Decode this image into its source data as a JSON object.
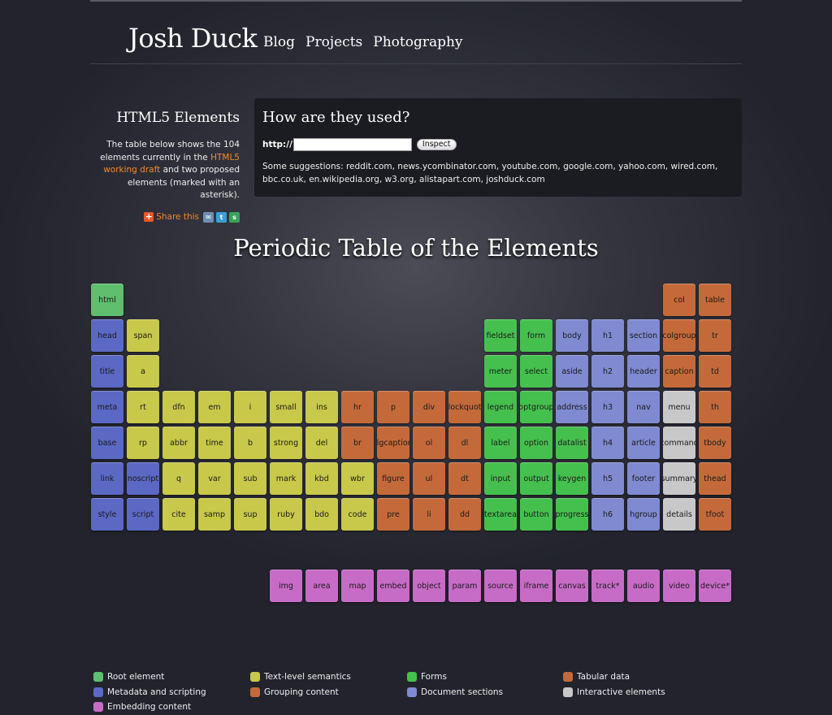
{
  "site": {
    "title": "Josh Duck",
    "nav": [
      "Blog",
      "Projects",
      "Photography"
    ]
  },
  "sidebar": {
    "heading": "HTML5 Elements",
    "intro_before": "The table below shows the 104 elements currently in the ",
    "link_text": "HTML5 working draft",
    "intro_after": " and two proposed elements (marked with an asterisk).",
    "share_label": "Share this"
  },
  "panel": {
    "heading": "How are they used?",
    "url_prefix": "http://",
    "url_value": "",
    "inspect_label": "Inspect",
    "suggestions": "Some suggestions: reddit.com, news.ycombinator.com, youtube.com, google.com, yahoo.com, wired.com, bbc.co.uk, en.wikipedia.org, w3.org, alistapart.com, joshduck.com"
  },
  "table_title": "Periodic Table of the Elements",
  "colors": {
    "root": "#5fbf6e",
    "meta": "#5b68c4",
    "text": "#c8c84a",
    "group": "#c46a3a",
    "form": "#45c04e",
    "section": "#7f8ad0",
    "tabular": "#c46a3a",
    "interactive": "#c8c8c8",
    "embed": "#c76cc6"
  },
  "elements": [
    {
      "n": "html",
      "c": "root",
      "col": 0,
      "row": 0
    },
    {
      "n": "head",
      "c": "meta",
      "col": 0,
      "row": 1
    },
    {
      "n": "title",
      "c": "meta",
      "col": 0,
      "row": 2
    },
    {
      "n": "meta",
      "c": "meta",
      "col": 0,
      "row": 3
    },
    {
      "n": "base",
      "c": "meta",
      "col": 0,
      "row": 4
    },
    {
      "n": "link",
      "c": "meta",
      "col": 0,
      "row": 5
    },
    {
      "n": "style",
      "c": "meta",
      "col": 0,
      "row": 6
    },
    {
      "n": "span",
      "c": "text",
      "col": 1,
      "row": 1
    },
    {
      "n": "a",
      "c": "text",
      "col": 1,
      "row": 2
    },
    {
      "n": "rt",
      "c": "text",
      "col": 1,
      "row": 3
    },
    {
      "n": "rp",
      "c": "text",
      "col": 1,
      "row": 4
    },
    {
      "n": "noscript",
      "c": "meta",
      "col": 1,
      "row": 5
    },
    {
      "n": "script",
      "c": "meta",
      "col": 1,
      "row": 6
    },
    {
      "n": "dfn",
      "c": "text",
      "col": 2,
      "row": 3
    },
    {
      "n": "abbr",
      "c": "text",
      "col": 2,
      "row": 4
    },
    {
      "n": "q",
      "c": "text",
      "col": 2,
      "row": 5
    },
    {
      "n": "cite",
      "c": "text",
      "col": 2,
      "row": 6
    },
    {
      "n": "em",
      "c": "text",
      "col": 3,
      "row": 3
    },
    {
      "n": "time",
      "c": "text",
      "col": 3,
      "row": 4
    },
    {
      "n": "var",
      "c": "text",
      "col": 3,
      "row": 5
    },
    {
      "n": "samp",
      "c": "text",
      "col": 3,
      "row": 6
    },
    {
      "n": "i",
      "c": "text",
      "col": 4,
      "row": 3
    },
    {
      "n": "b",
      "c": "text",
      "col": 4,
      "row": 4
    },
    {
      "n": "sub",
      "c": "text",
      "col": 4,
      "row": 5
    },
    {
      "n": "sup",
      "c": "text",
      "col": 4,
      "row": 6
    },
    {
      "n": "small",
      "c": "text",
      "col": 5,
      "row": 3
    },
    {
      "n": "strong",
      "c": "text",
      "col": 5,
      "row": 4
    },
    {
      "n": "mark",
      "c": "text",
      "col": 5,
      "row": 5
    },
    {
      "n": "ruby",
      "c": "text",
      "col": 5,
      "row": 6
    },
    {
      "n": "ins",
      "c": "text",
      "col": 6,
      "row": 3
    },
    {
      "n": "del",
      "c": "text",
      "col": 6,
      "row": 4
    },
    {
      "n": "kbd",
      "c": "text",
      "col": 6,
      "row": 5
    },
    {
      "n": "bdo",
      "c": "text",
      "col": 6,
      "row": 6
    },
    {
      "n": "hr",
      "c": "group",
      "col": 7,
      "row": 3
    },
    {
      "n": "br",
      "c": "group",
      "col": 7,
      "row": 4
    },
    {
      "n": "wbr",
      "c": "text",
      "col": 7,
      "row": 5
    },
    {
      "n": "code",
      "c": "text",
      "col": 7,
      "row": 6
    },
    {
      "n": "p",
      "c": "group",
      "col": 8,
      "row": 3
    },
    {
      "n": "figcaption",
      "c": "group",
      "col": 8,
      "row": 4
    },
    {
      "n": "figure",
      "c": "group",
      "col": 8,
      "row": 5
    },
    {
      "n": "pre",
      "c": "group",
      "col": 8,
      "row": 6
    },
    {
      "n": "div",
      "c": "group",
      "col": 9,
      "row": 3
    },
    {
      "n": "ol",
      "c": "group",
      "col": 9,
      "row": 4
    },
    {
      "n": "ul",
      "c": "group",
      "col": 9,
      "row": 5
    },
    {
      "n": "li",
      "c": "group",
      "col": 9,
      "row": 6
    },
    {
      "n": "blockquote",
      "c": "group",
      "col": 10,
      "row": 3
    },
    {
      "n": "dl",
      "c": "group",
      "col": 10,
      "row": 4
    },
    {
      "n": "dt",
      "c": "group",
      "col": 10,
      "row": 5
    },
    {
      "n": "dd",
      "c": "group",
      "col": 10,
      "row": 6
    },
    {
      "n": "fieldset",
      "c": "form",
      "col": 11,
      "row": 1
    },
    {
      "n": "meter",
      "c": "form",
      "col": 11,
      "row": 2
    },
    {
      "n": "legend",
      "c": "form",
      "col": 11,
      "row": 3
    },
    {
      "n": "label",
      "c": "form",
      "col": 11,
      "row": 4
    },
    {
      "n": "input",
      "c": "form",
      "col": 11,
      "row": 5
    },
    {
      "n": "textarea",
      "c": "form",
      "col": 11,
      "row": 6
    },
    {
      "n": "form",
      "c": "form",
      "col": 12,
      "row": 1
    },
    {
      "n": "select",
      "c": "form",
      "col": 12,
      "row": 2
    },
    {
      "n": "optgroup",
      "c": "form",
      "col": 12,
      "row": 3
    },
    {
      "n": "option",
      "c": "form",
      "col": 12,
      "row": 4
    },
    {
      "n": "output",
      "c": "form",
      "col": 12,
      "row": 5
    },
    {
      "n": "button",
      "c": "form",
      "col": 12,
      "row": 6
    },
    {
      "n": "body",
      "c": "section",
      "col": 13,
      "row": 1
    },
    {
      "n": "aside",
      "c": "section",
      "col": 13,
      "row": 2
    },
    {
      "n": "address",
      "c": "section",
      "col": 13,
      "row": 3
    },
    {
      "n": "datalist",
      "c": "form",
      "col": 13,
      "row": 4
    },
    {
      "n": "keygen",
      "c": "form",
      "col": 13,
      "row": 5
    },
    {
      "n": "progress",
      "c": "form",
      "col": 13,
      "row": 6
    },
    {
      "n": "h1",
      "c": "section",
      "col": 14,
      "row": 1
    },
    {
      "n": "h2",
      "c": "section",
      "col": 14,
      "row": 2
    },
    {
      "n": "h3",
      "c": "section",
      "col": 14,
      "row": 3
    },
    {
      "n": "h4",
      "c": "section",
      "col": 14,
      "row": 4
    },
    {
      "n": "h5",
      "c": "section",
      "col": 14,
      "row": 5
    },
    {
      "n": "h6",
      "c": "section",
      "col": 14,
      "row": 6
    },
    {
      "n": "section",
      "c": "section",
      "col": 15,
      "row": 1
    },
    {
      "n": "header",
      "c": "section",
      "col": 15,
      "row": 2
    },
    {
      "n": "nav",
      "c": "section",
      "col": 15,
      "row": 3
    },
    {
      "n": "article",
      "c": "section",
      "col": 15,
      "row": 4
    },
    {
      "n": "footer",
      "c": "section",
      "col": 15,
      "row": 5
    },
    {
      "n": "hgroup",
      "c": "section",
      "col": 15,
      "row": 6
    },
    {
      "n": "col",
      "c": "tabular",
      "col": 16,
      "row": 0
    },
    {
      "n": "colgroup",
      "c": "tabular",
      "col": 16,
      "row": 1
    },
    {
      "n": "caption",
      "c": "tabular",
      "col": 16,
      "row": 2
    },
    {
      "n": "menu",
      "c": "interactive",
      "col": 16,
      "row": 3
    },
    {
      "n": "command",
      "c": "interactive",
      "col": 16,
      "row": 4
    },
    {
      "n": "summary",
      "c": "interactive",
      "col": 16,
      "row": 5
    },
    {
      "n": "details",
      "c": "interactive",
      "col": 16,
      "row": 6
    },
    {
      "n": "table",
      "c": "tabular",
      "col": 17,
      "row": 0
    },
    {
      "n": "tr",
      "c": "tabular",
      "col": 17,
      "row": 1
    },
    {
      "n": "td",
      "c": "tabular",
      "col": 17,
      "row": 2
    },
    {
      "n": "th",
      "c": "tabular",
      "col": 17,
      "row": 3
    },
    {
      "n": "tbody",
      "c": "tabular",
      "col": 17,
      "row": 4
    },
    {
      "n": "thead",
      "c": "tabular",
      "col": 17,
      "row": 5
    },
    {
      "n": "tfoot",
      "c": "tabular",
      "col": 17,
      "row": 6
    },
    {
      "n": "img",
      "c": "embed",
      "col": 5,
      "row": 8
    },
    {
      "n": "area",
      "c": "embed",
      "col": 6,
      "row": 8
    },
    {
      "n": "map",
      "c": "embed",
      "col": 7,
      "row": 8
    },
    {
      "n": "embed",
      "c": "embed",
      "col": 8,
      "row": 8
    },
    {
      "n": "object",
      "c": "embed",
      "col": 9,
      "row": 8
    },
    {
      "n": "param",
      "c": "embed",
      "col": 10,
      "row": 8
    },
    {
      "n": "source",
      "c": "embed",
      "col": 11,
      "row": 8
    },
    {
      "n": "iframe",
      "c": "embed",
      "col": 12,
      "row": 8
    },
    {
      "n": "canvas",
      "c": "embed",
      "col": 13,
      "row": 8
    },
    {
      "n": "track*",
      "c": "embed",
      "col": 14,
      "row": 8
    },
    {
      "n": "audio",
      "c": "embed",
      "col": 15,
      "row": 8
    },
    {
      "n": "video",
      "c": "embed",
      "col": 16,
      "row": 8
    },
    {
      "n": "device*",
      "c": "embed",
      "col": 17,
      "row": 8
    }
  ],
  "legend": [
    {
      "label": "Root element",
      "c": "root"
    },
    {
      "label": "Text-level semantics",
      "c": "text"
    },
    {
      "label": "Forms",
      "c": "form"
    },
    {
      "label": "Tabular data",
      "c": "tabular"
    },
    {
      "label": "Metadata and scripting",
      "c": "meta"
    },
    {
      "label": "Grouping content",
      "c": "group"
    },
    {
      "label": "Document sections",
      "c": "section"
    },
    {
      "label": "Interactive elements",
      "c": "interactive"
    },
    {
      "label": "Embedding content",
      "c": "embed"
    }
  ]
}
